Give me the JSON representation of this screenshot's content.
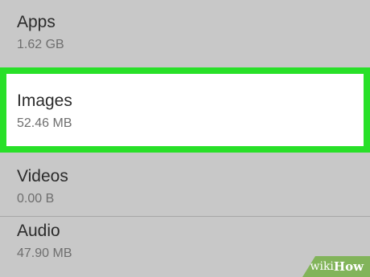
{
  "storage_list": {
    "items": [
      {
        "title": "Apps",
        "size": "1.62 GB"
      },
      {
        "title": "Images",
        "size": "52.46 MB"
      },
      {
        "title": "Videos",
        "size": "0.00 B"
      },
      {
        "title": "Audio",
        "size": "47.90 MB"
      }
    ]
  },
  "highlight": {
    "color": "#28e028"
  },
  "watermark": {
    "part1": "wiki",
    "part2": "How"
  }
}
